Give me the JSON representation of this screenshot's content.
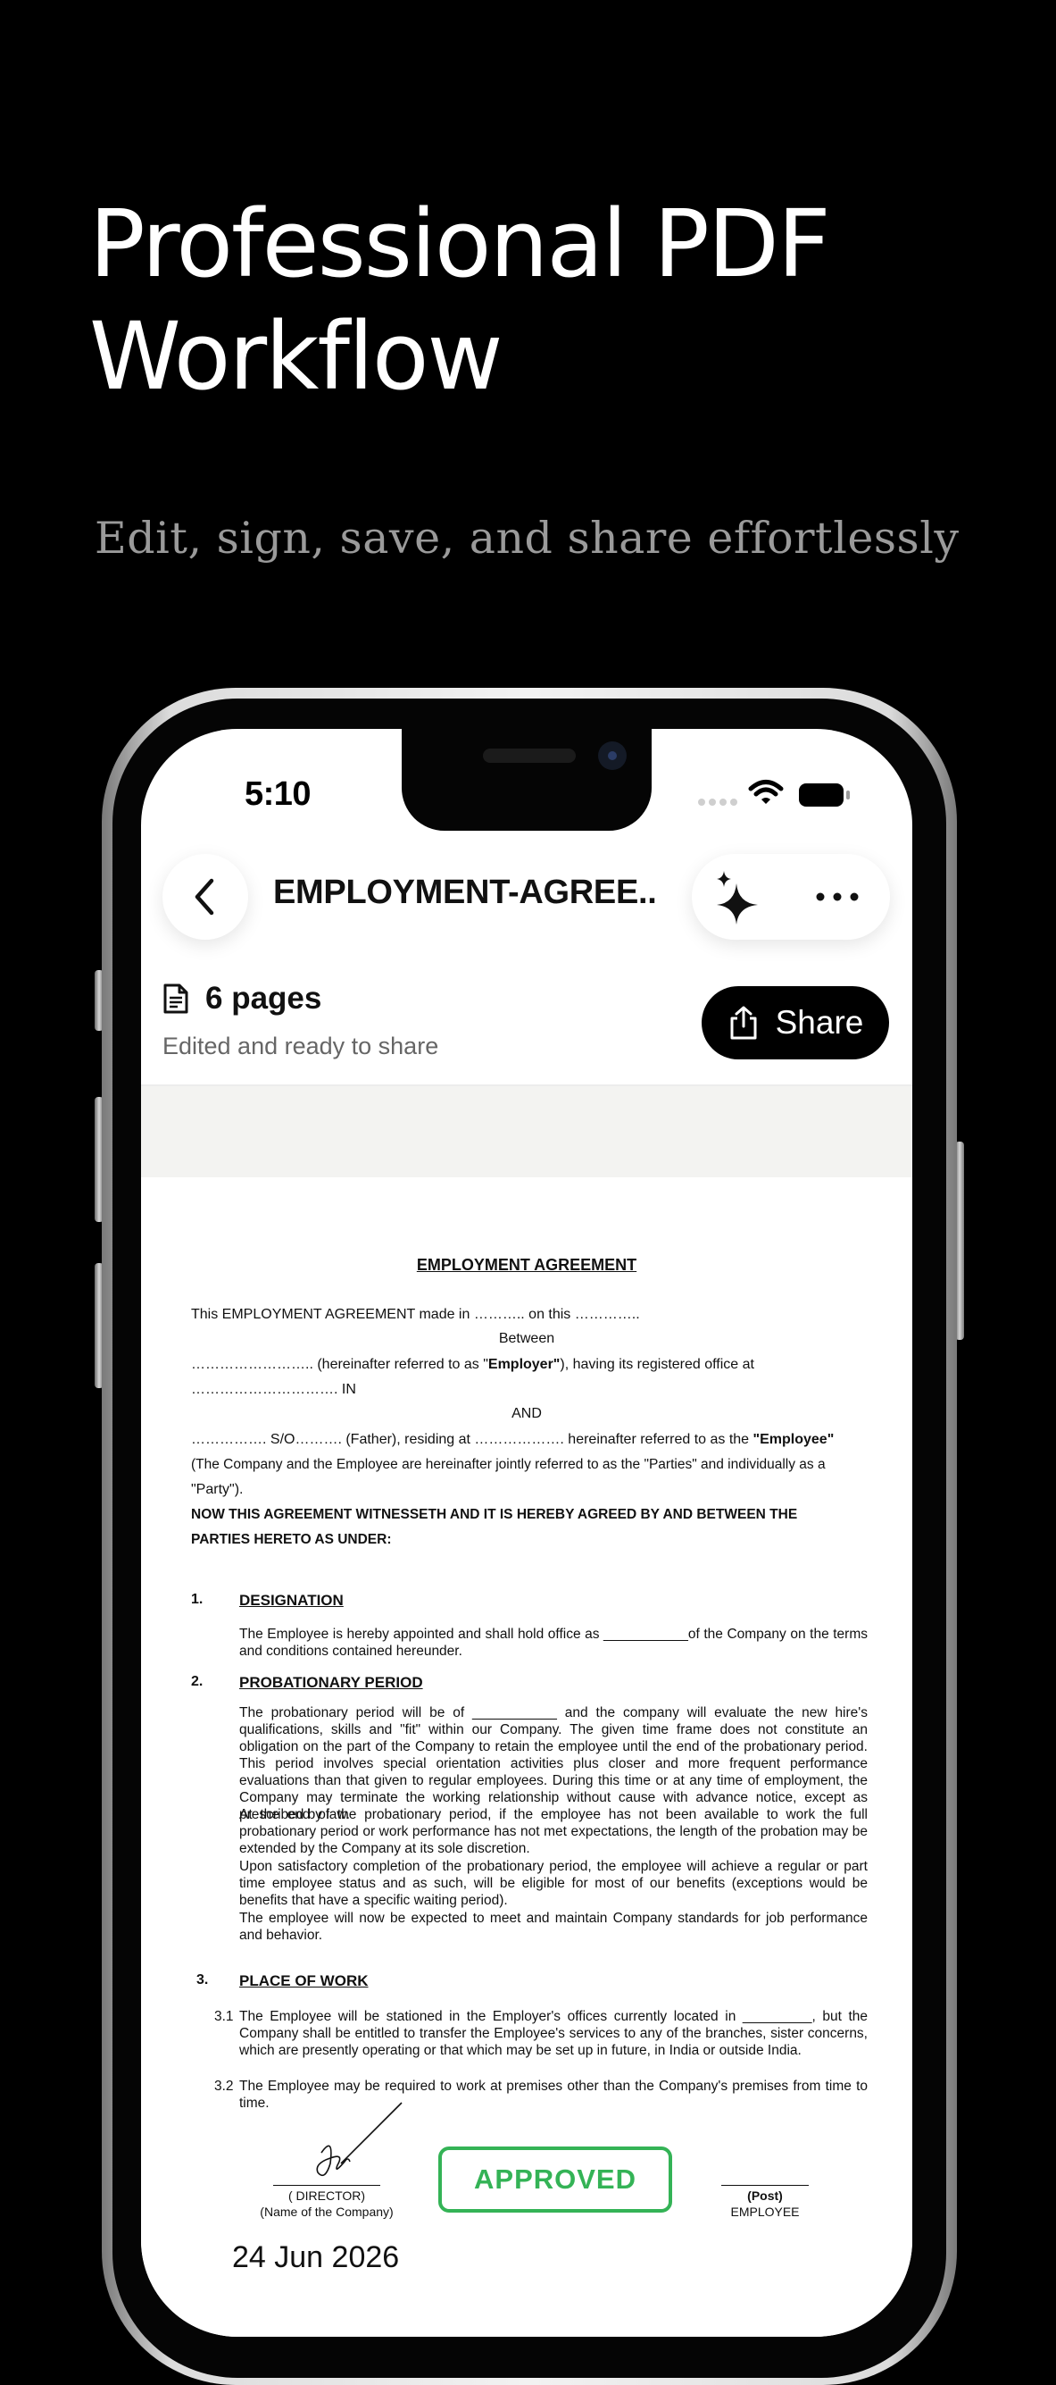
{
  "hero": {
    "title_line1": "Professional PDF",
    "title_line2": "Workflow",
    "subtitle": "Edit, sign, save, and share effortlessly"
  },
  "status_bar": {
    "time": "5:10"
  },
  "toolbar": {
    "back_icon": "chevron-left-icon",
    "title": "EMPLOYMENT-AGREE...",
    "sparkle_icon": "sparkle-icon",
    "more_icon": "more-dots-icon"
  },
  "doc_info": {
    "pages": "6 pages",
    "status": "Edited and ready to share",
    "share_label": "Share"
  },
  "document": {
    "heading": "EMPLOYMENT AGREEMENT",
    "intro_line1": "This EMPLOYMENT AGREEMENT made in ……….. on this …………..",
    "between": "Between",
    "employer_pre": "…………………….. (hereinafter referred to as \"",
    "employer_word": "Employer\"",
    "employer_post": "), having its registered office at",
    "employer_line2": "…………………………. IN",
    "and": "AND",
    "employee_pre": "……………. S/O………. (Father), residing at ………………. hereinafter referred to as the ",
    "employee_word": "\"Employee\"",
    "parties_line1": "(The Company and the Employee are hereinafter jointly referred to as the \"Parties\" and individually as a",
    "parties_line2": "\"Party\").",
    "witness_line1": "NOW THIS AGREEMENT WITNESSETH AND IT IS HEREBY AGREED BY AND BETWEEN THE",
    "witness_line2": "PARTIES HERETO AS UNDER:",
    "s1_num": "1.",
    "s1_head": "DESIGNATION",
    "s1_body": "The Employee is hereby appointed and shall hold office as ___________of the Company on the terms and conditions contained hereunder.",
    "s2_num": "2.",
    "s2_head": "PROBATIONARY PERIOD",
    "s2_p1": "The probationary period will be of ___________ and the company will evaluate the new hire's qualifications, skills and \"fit\" within our Company. The given time frame does not constitute an obligation on the part of the Company to retain the employee until the end of the probationary period. This period involves special orientation activities plus closer and more frequent performance evaluations than that given to regular employees. During this time or at any time of employment, the Company may terminate the working relationship without cause with advance notice, except as prescribed by law.",
    "s2_p2": "At the end of the probationary period, if the employee has not been available to work the full probationary period or work performance has not met expectations, the length of the probation may be extended by the Company at its sole discretion.",
    "s2_p3": "Upon satisfactory completion of the probationary period, the employee will achieve a regular or part time employee status and as such, will be eligible for most of our benefits (exceptions would be benefits that have a specific waiting period).",
    "s2_p4": "The employee will now be expected to meet and maintain Company standards for job performance and behavior.",
    "s3_num": "3.",
    "s3_head": "PLACE OF WORK",
    "s31_num": "3.1",
    "s31_body": "The Employee will be stationed in the Employer's offices currently located in _________, but the Company shall be entitled to transfer the Employee's services to any of the branches, sister concerns, which are presently operating or that which may be set up in future, in India or outside India.",
    "s32_num": "3.2",
    "s32_body": "The Employee may be required to work at premises other than the Company's premises from time to time.",
    "director_label": "( DIRECTOR)",
    "company_label": "(Name of the Company)",
    "post_label": "(Post)",
    "employee_label": "EMPLOYEE",
    "stamp": "APPROVED",
    "date": "24 Jun 2026"
  },
  "colors": {
    "stamp_green": "#34b356",
    "background": "#000000"
  }
}
